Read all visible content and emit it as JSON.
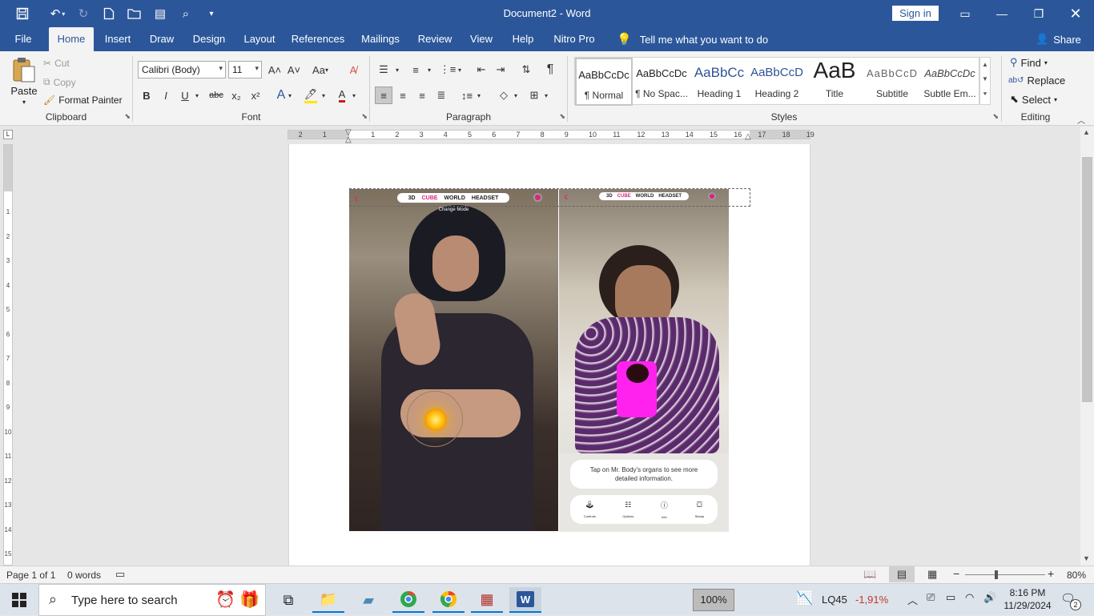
{
  "titlebar": {
    "title": "Document2 - Word",
    "sign_in": "Sign in"
  },
  "tabs": [
    "File",
    "Home",
    "Insert",
    "Draw",
    "Design",
    "Layout",
    "References",
    "Mailings",
    "Review",
    "View",
    "Help",
    "Nitro Pro"
  ],
  "active_tab": "Home",
  "tell_me": "Tell me what you want to do",
  "share": "Share",
  "clipboard": {
    "paste": "Paste",
    "cut": "Cut",
    "copy": "Copy",
    "format_painter": "Format Painter",
    "label": "Clipboard"
  },
  "font": {
    "name": "Calibri (Body)",
    "size": "11",
    "label": "Font",
    "grow": "A˄",
    "shrink": "A˅",
    "case": "Aa",
    "bold": "B",
    "italic": "I",
    "underline": "U",
    "strike": "abc",
    "sub": "x₂",
    "sup": "x²",
    "font_color": "A"
  },
  "paragraph": {
    "label": "Paragraph",
    "pilcrow": "¶"
  },
  "styles": {
    "label": "Styles",
    "items": [
      {
        "preview": "AaBbCcDc",
        "name": "¶ Normal"
      },
      {
        "preview": "AaBbCcDc",
        "name": "¶ No Spac..."
      },
      {
        "preview": "AaBbCc",
        "name": "Heading 1"
      },
      {
        "preview": "AaBbCcD",
        "name": "Heading 2"
      },
      {
        "preview": "AaB",
        "name": "Title"
      },
      {
        "preview": "AaBbCcD",
        "name": "Subtitle"
      },
      {
        "preview": "AaBbCcDc",
        "name": "Subtle Em..."
      }
    ]
  },
  "editing": {
    "find": "Find",
    "replace": "Replace",
    "select": "Select",
    "label": "Editing"
  },
  "ruler": {
    "numbers": [
      "2",
      "1",
      "1",
      "2",
      "3",
      "4",
      "5",
      "6",
      "7",
      "8",
      "9",
      "10",
      "11",
      "12",
      "13",
      "14",
      "15",
      "16",
      "17",
      "18",
      "19"
    ],
    "vnumbers": [
      "1",
      "2",
      "3",
      "4",
      "5",
      "6",
      "7",
      "8",
      "9",
      "10",
      "11",
      "12",
      "13",
      "14",
      "15"
    ]
  },
  "figure": {
    "left": {
      "header": [
        "3D",
        "CUBE",
        "WORLD",
        "HEADSET"
      ],
      "change_mode": "Change Mode"
    },
    "right": {
      "header": [
        "3D",
        "CUBE",
        "WORLD",
        "HEADSET"
      ],
      "caption": "Tap on Mr. Body's organs to see more detailed information.",
      "buttons": [
        "Controls",
        "Options",
        "Info",
        "Stamp"
      ]
    },
    "accent_color": "#e0237a"
  },
  "status": {
    "page": "Page 1 of 1",
    "words": "0 words",
    "zoom": "80%"
  },
  "taskbar": {
    "search": "Type here to search",
    "zoom_badge": "100%",
    "stock_name": "LQ45",
    "stock_change": "-1,91%",
    "time": "8:16 PM",
    "date": "11/29/2024",
    "notif_count": "2"
  }
}
